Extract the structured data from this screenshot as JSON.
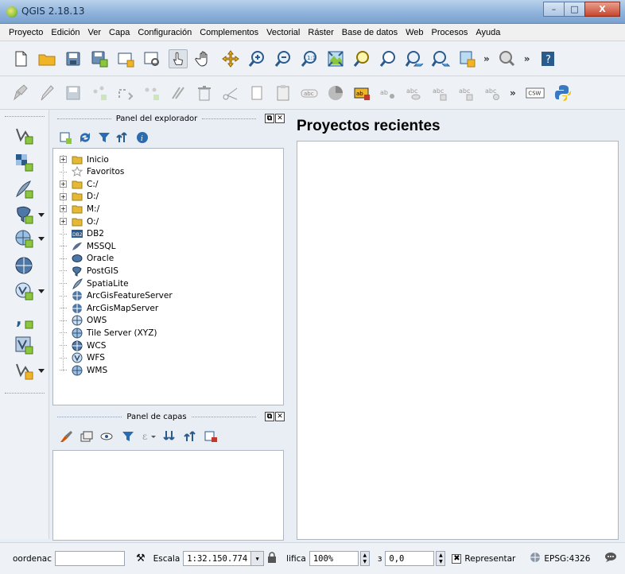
{
  "window": {
    "title": "QGIS 2.18.13",
    "minimize": "–",
    "maximize": "□",
    "close": "X"
  },
  "menu": [
    "Proyecto",
    "Edición",
    "Ver",
    "Capa",
    "Configuración",
    "Complementos",
    "Vectorial",
    "Ráster",
    "Base de datos",
    "Web",
    "Procesos",
    "Ayuda"
  ],
  "toolbar1": {
    "icons": [
      "new-project-icon",
      "open-project-icon",
      "save-project-icon",
      "save-as-icon",
      "new-print-composer-icon",
      "composer-manager-icon",
      "touch-zoom-icon",
      "pan-icon",
      "pan-to-selection-icon",
      "zoom-in-icon",
      "zoom-out-icon",
      "zoom-native-icon",
      "zoom-full-icon",
      "zoom-to-selection-icon",
      "zoom-to-layer-icon",
      "zoom-last-icon",
      "zoom-next-icon",
      "new-bookmark-icon"
    ],
    "overflow": "»",
    "overflow2": "»"
  },
  "toolbar2": {
    "icons": [
      "current-edits-icon",
      "toggle-editing-icon",
      "save-edits-icon",
      "add-feature-icon",
      "move-feature-icon",
      "node-tool-icon",
      "delete-selected-icon",
      "cut-features-icon",
      "copy-features-icon",
      "paste-features-icon",
      "label-toolbar-icon",
      "diagram-icon",
      "highlight-pinned-labels-icon",
      "pin-label-icon",
      "show-hide-label-icon",
      "move-label-icon",
      "rotate-label-icon",
      "change-label-icon",
      "csw-icon",
      "python-icon"
    ],
    "overflow": "»",
    "csw_label": "CSW"
  },
  "explorer": {
    "title": "Panel del explorador",
    "items": [
      {
        "label": "Inicio",
        "icon": "folder-icon",
        "expandable": true
      },
      {
        "label": "Favoritos",
        "icon": "star-icon",
        "expandable": false
      },
      {
        "label": "C:/",
        "icon": "folder-icon",
        "expandable": true
      },
      {
        "label": "D:/",
        "icon": "folder-icon",
        "expandable": true
      },
      {
        "label": "M:/",
        "icon": "folder-icon",
        "expandable": true
      },
      {
        "label": "O:/",
        "icon": "folder-icon",
        "expandable": true
      },
      {
        "label": "DB2",
        "icon": "db2-icon",
        "expandable": false
      },
      {
        "label": "MSSQL",
        "icon": "mssql-icon",
        "expandable": false
      },
      {
        "label": "Oracle",
        "icon": "oracle-icon",
        "expandable": false
      },
      {
        "label": "PostGIS",
        "icon": "postgis-icon",
        "expandable": false
      },
      {
        "label": "SpatiaLite",
        "icon": "spatialite-icon",
        "expandable": false
      },
      {
        "label": "ArcGisFeatureServer",
        "icon": "arcgis-feature-icon",
        "expandable": false
      },
      {
        "label": "ArcGisMapServer",
        "icon": "arcgis-map-icon",
        "expandable": false
      },
      {
        "label": "OWS",
        "icon": "ows-icon",
        "expandable": false
      },
      {
        "label": "Tile Server (XYZ)",
        "icon": "tile-server-icon",
        "expandable": false
      },
      {
        "label": "WCS",
        "icon": "wcs-icon",
        "expandable": false
      },
      {
        "label": "WFS",
        "icon": "wfs-icon",
        "expandable": false
      },
      {
        "label": "WMS",
        "icon": "wms-icon",
        "expandable": false
      }
    ]
  },
  "layers": {
    "title": "Panel de capas"
  },
  "recent": {
    "title": "Proyectos recientes"
  },
  "status": {
    "coord_label": "oordenac",
    "coord_value": "",
    "scale_label": "Escala",
    "scale_value": "1:32.150.774",
    "magnify_label": "lifica",
    "magnify_value": "100%",
    "rotation_label": "ɜ",
    "rotation_value": "0,0",
    "render_label": "Representar",
    "render_check": "✖",
    "crs": "EPSG:4326"
  },
  "colors": {
    "accent": "#3a78c2",
    "folder": "#e6b935",
    "titlebar": "#8fb3dc"
  }
}
